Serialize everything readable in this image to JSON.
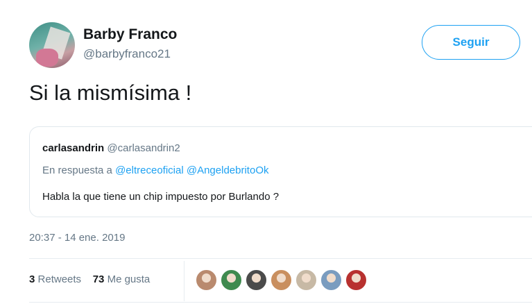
{
  "tweet": {
    "author": {
      "name": "Barby Franco",
      "handle": "@barbyfranco21"
    },
    "follow_label": "Seguir",
    "text": "Si la mismísima !",
    "quoted": {
      "name": "carlasandrin",
      "handle": "@carlasandrin2",
      "reply_prefix": "En respuesta a",
      "reply_to": [
        "@eltreceoficial",
        "@AngeldebritoOk"
      ],
      "text": "Habla la que tiene un chip impuesto por Burlando ?"
    },
    "timestamp": "20:37 - 14 ene. 2019",
    "stats": {
      "retweets_count": "3",
      "retweets_label": "Retweets",
      "likes_count": "73",
      "likes_label": "Me gusta"
    },
    "likers": [
      {
        "color": "#b98a6e"
      },
      {
        "color": "#3f8a4f"
      },
      {
        "color": "#4b4b4b"
      },
      {
        "color": "#c98f5f"
      },
      {
        "color": "#c7b9a5"
      },
      {
        "color": "#7a9cbf"
      },
      {
        "color": "#b8312f"
      }
    ]
  },
  "colors": {
    "accent": "#1da1f2",
    "secondary_text": "#657786",
    "divider": "#e6ecf0"
  }
}
